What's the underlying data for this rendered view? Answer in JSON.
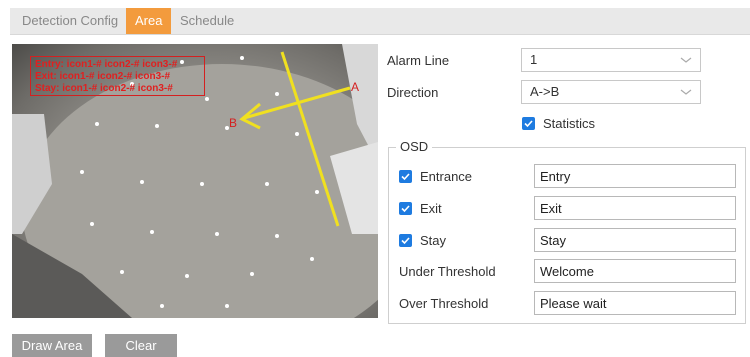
{
  "tabs": [
    {
      "label": "Detection Config",
      "active": false
    },
    {
      "label": "Area",
      "active": true
    },
    {
      "label": "Schedule",
      "active": false
    }
  ],
  "accent_color": "#f39b3d",
  "checkbox_color": "#1e7be0",
  "video": {
    "osd_lines": [
      "Entry: icon1-# icon2-# icon3-#",
      "Exit: icon1-# icon2-# icon3-#",
      "Stay: icon1-# icon2-# icon3-#"
    ],
    "marker_a": "A",
    "marker_b": "B"
  },
  "settings": {
    "alarm_line_label": "Alarm Line",
    "alarm_line_value": "1",
    "direction_label": "Direction",
    "direction_value": "A->B",
    "statistics_label": "Statistics",
    "statistics_checked": true
  },
  "osd": {
    "legend": "OSD",
    "entrance_label": "Entrance",
    "entrance_checked": true,
    "entrance_value": "Entry",
    "exit_label": "Exit",
    "exit_checked": true,
    "exit_value": "Exit",
    "stay_label": "Stay",
    "stay_checked": true,
    "stay_value": "Stay",
    "under_threshold_label": "Under Threshold",
    "under_threshold_value": "Welcome",
    "over_threshold_label": "Over Threshold",
    "over_threshold_value": "Please wait"
  },
  "buttons": {
    "draw_area": "Draw Area",
    "clear": "Clear"
  }
}
